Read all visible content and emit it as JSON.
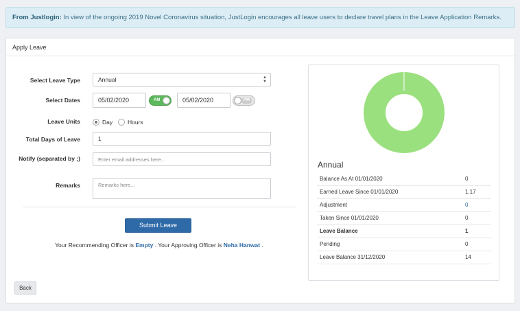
{
  "alert": {
    "prefix": "From Justlogin:",
    "message": " In view of the ongoing 2019 Novel Coronavirus situation, JustLogin encourages all leave users to declare travel plans in the Leave Application Remarks."
  },
  "panel": {
    "title": "Apply Leave"
  },
  "form": {
    "leave_type_label": "Select Leave Type",
    "leave_type_value": "Annual",
    "dates_label": "Select Dates",
    "start_date": "05/02/2020",
    "start_toggle": "AM",
    "end_date": "05/02/2020",
    "end_toggle": "PM",
    "units_label": "Leave Units",
    "unit_day": "Day",
    "unit_hours": "Hours",
    "total_label": "Total Days of Leave",
    "total_value": "1",
    "notify_label": "Notify (separated by ;)",
    "notify_placeholder": "Enter email addresses here...",
    "remarks_label": "Remarks",
    "remarks_placeholder": "Remarks here..."
  },
  "actions": {
    "submit": "Submit Leave",
    "back": "Back"
  },
  "officer": {
    "prefix": "Your Recommending Officer is ",
    "recommending": "Empty",
    "middle": " . Your Approving Officer is ",
    "approving": "Neha Hanwat",
    "suffix": " ."
  },
  "summary": {
    "title": "Annual",
    "chart_color": "#9be07f",
    "rows": [
      {
        "label": "Balance As At 01/01/2020",
        "value": "0"
      },
      {
        "label": "Earned Leave Since 01/01/2020",
        "value": "1.17"
      },
      {
        "label": "Adjustment",
        "value": "0"
      },
      {
        "label": "Taken Since 01/01/2020",
        "value": "0"
      },
      {
        "label": "Leave Balance",
        "value": "1"
      },
      {
        "label": "Pending",
        "value": "0"
      },
      {
        "label": "Leave Balance 31/12/2020",
        "value": "14"
      }
    ]
  }
}
